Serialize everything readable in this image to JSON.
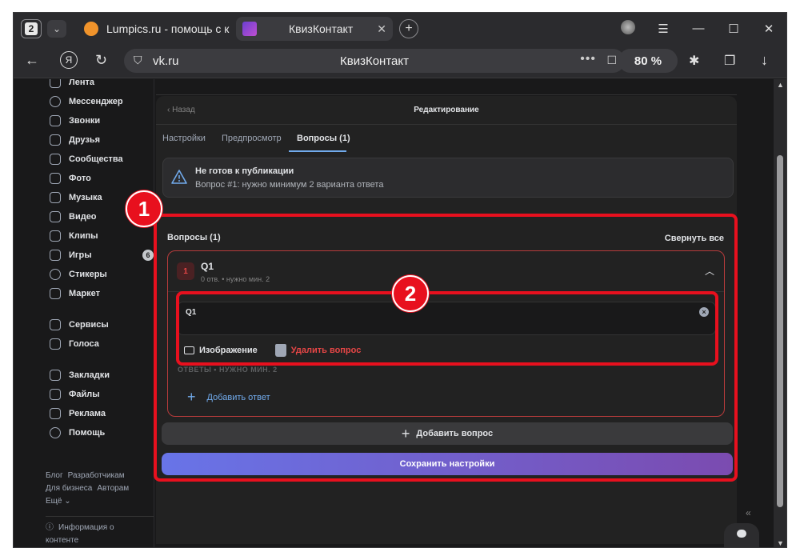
{
  "browser": {
    "tab_count": "2",
    "tabs": [
      {
        "title": "Lumpics.ru - помощь с ко",
        "close": "✕"
      },
      {
        "title": "КвизКонтакт",
        "close": "✕"
      }
    ],
    "new_tab": "+",
    "url": "vk.ru",
    "page_title": "КвизКонтакт",
    "zoom": "80 %"
  },
  "sidebar": {
    "items": [
      {
        "label": "Лента"
      },
      {
        "label": "Мессенджер"
      },
      {
        "label": "Звонки"
      },
      {
        "label": "Друзья"
      },
      {
        "label": "Сообщества"
      },
      {
        "label": "Фото"
      },
      {
        "label": "Музыка"
      },
      {
        "label": "Видео"
      },
      {
        "label": "Клипы"
      },
      {
        "label": "Игры",
        "badge": "6"
      },
      {
        "label": "Стикеры"
      },
      {
        "label": "Маркет"
      },
      {
        "label": "Сервисы"
      },
      {
        "label": "Голоса"
      },
      {
        "label": "Закладки"
      },
      {
        "label": "Файлы"
      },
      {
        "label": "Реклама"
      },
      {
        "label": "Помощь"
      }
    ],
    "footer": {
      "blog": "Блог",
      "developers": "Разработчикам",
      "business": "Для бизнеса",
      "authors": "Авторам",
      "more": "Ещё ⌄",
      "content_info": "Информация о контенте"
    }
  },
  "editor": {
    "back": "Назад",
    "title": "Редактирование",
    "tabs": [
      "Настройки",
      "Предпросмотр",
      "Вопросы (1)"
    ],
    "warning": {
      "title": "Не готов к публикации",
      "text": "Вопрос #1: нужно минимум 2 варианта ответа"
    },
    "questions_header": "Вопросы (1)",
    "collapse_all": "Свернуть все",
    "question": {
      "number": "1",
      "title": "Q1",
      "subtitle": "0 отв. • нужно мин. 2",
      "input_value": "Q1",
      "image_label": "Изображение",
      "delete_label": "Удалить вопрос",
      "answers_label": "ОТВЕТЫ • НУЖНО МИН. 2",
      "add_answer": "Добавить ответ"
    },
    "add_question": "Добавить вопрос",
    "save": "Сохранить настройки"
  },
  "annotations": {
    "marker1": "1",
    "marker2": "2",
    "highlight_color": "#e8101e"
  }
}
